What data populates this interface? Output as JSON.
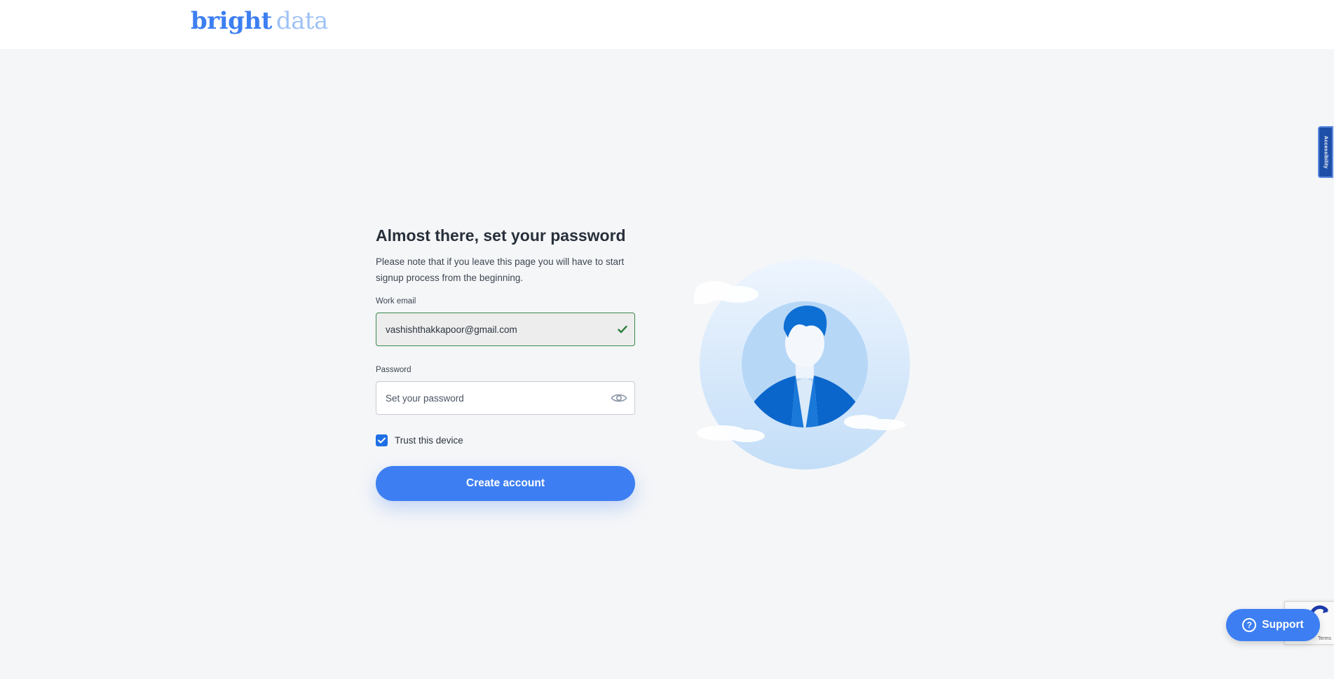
{
  "header": {
    "logo_word1": "bright",
    "logo_word2": "data"
  },
  "form": {
    "title": "Almost there, set your password",
    "note": "Please note that if you leave this page you will have to start signup process from the beginning.",
    "email_label": "Work email",
    "email_value": "vashishthakkapoor@gmail.com",
    "password_label": "Password",
    "password_placeholder": "Set your password",
    "trust_label": "Trust this device",
    "trust_checked": true,
    "submit_label": "Create account"
  },
  "widgets": {
    "accessibility_label": "Accessibility",
    "support_label": "Support",
    "support_icon": "?",
    "recaptcha_terms": "Terms"
  },
  "colors": {
    "brand_primary": "#3d7ff2",
    "brand_light": "#9ec2f7",
    "valid_border": "#3b8a4d",
    "page_bg": "#f5f6f8"
  },
  "icons": {
    "email_valid": "check-icon",
    "password_toggle": "eye-icon",
    "checkbox": "checkmark-icon",
    "illustration": "user-avatar-illustration"
  }
}
